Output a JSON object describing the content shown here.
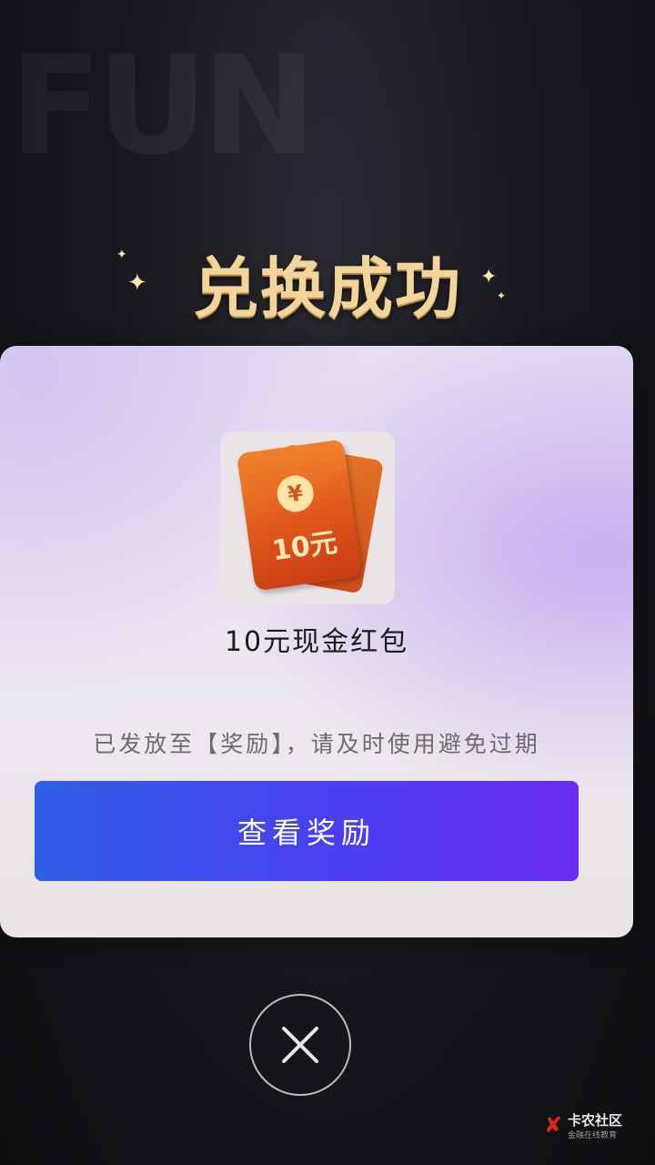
{
  "header": {
    "title": "兑换成功"
  },
  "card": {
    "reward_image": {
      "amount_label": "10元",
      "coin_symbol": "¥"
    },
    "reward_name": "10元现金红包",
    "notice": "已发放至【奖励】，请及时使用避免过期",
    "view_button_label": "查看奖励"
  },
  "close_icon": "close-icon",
  "brand": {
    "name": "卡农社区",
    "sub": "金融在线教育"
  },
  "colors": {
    "title": "#f2d59a",
    "button_start": "#2f5ee6",
    "button_end": "#6a2cf2",
    "envelope": "#e15a1c"
  }
}
